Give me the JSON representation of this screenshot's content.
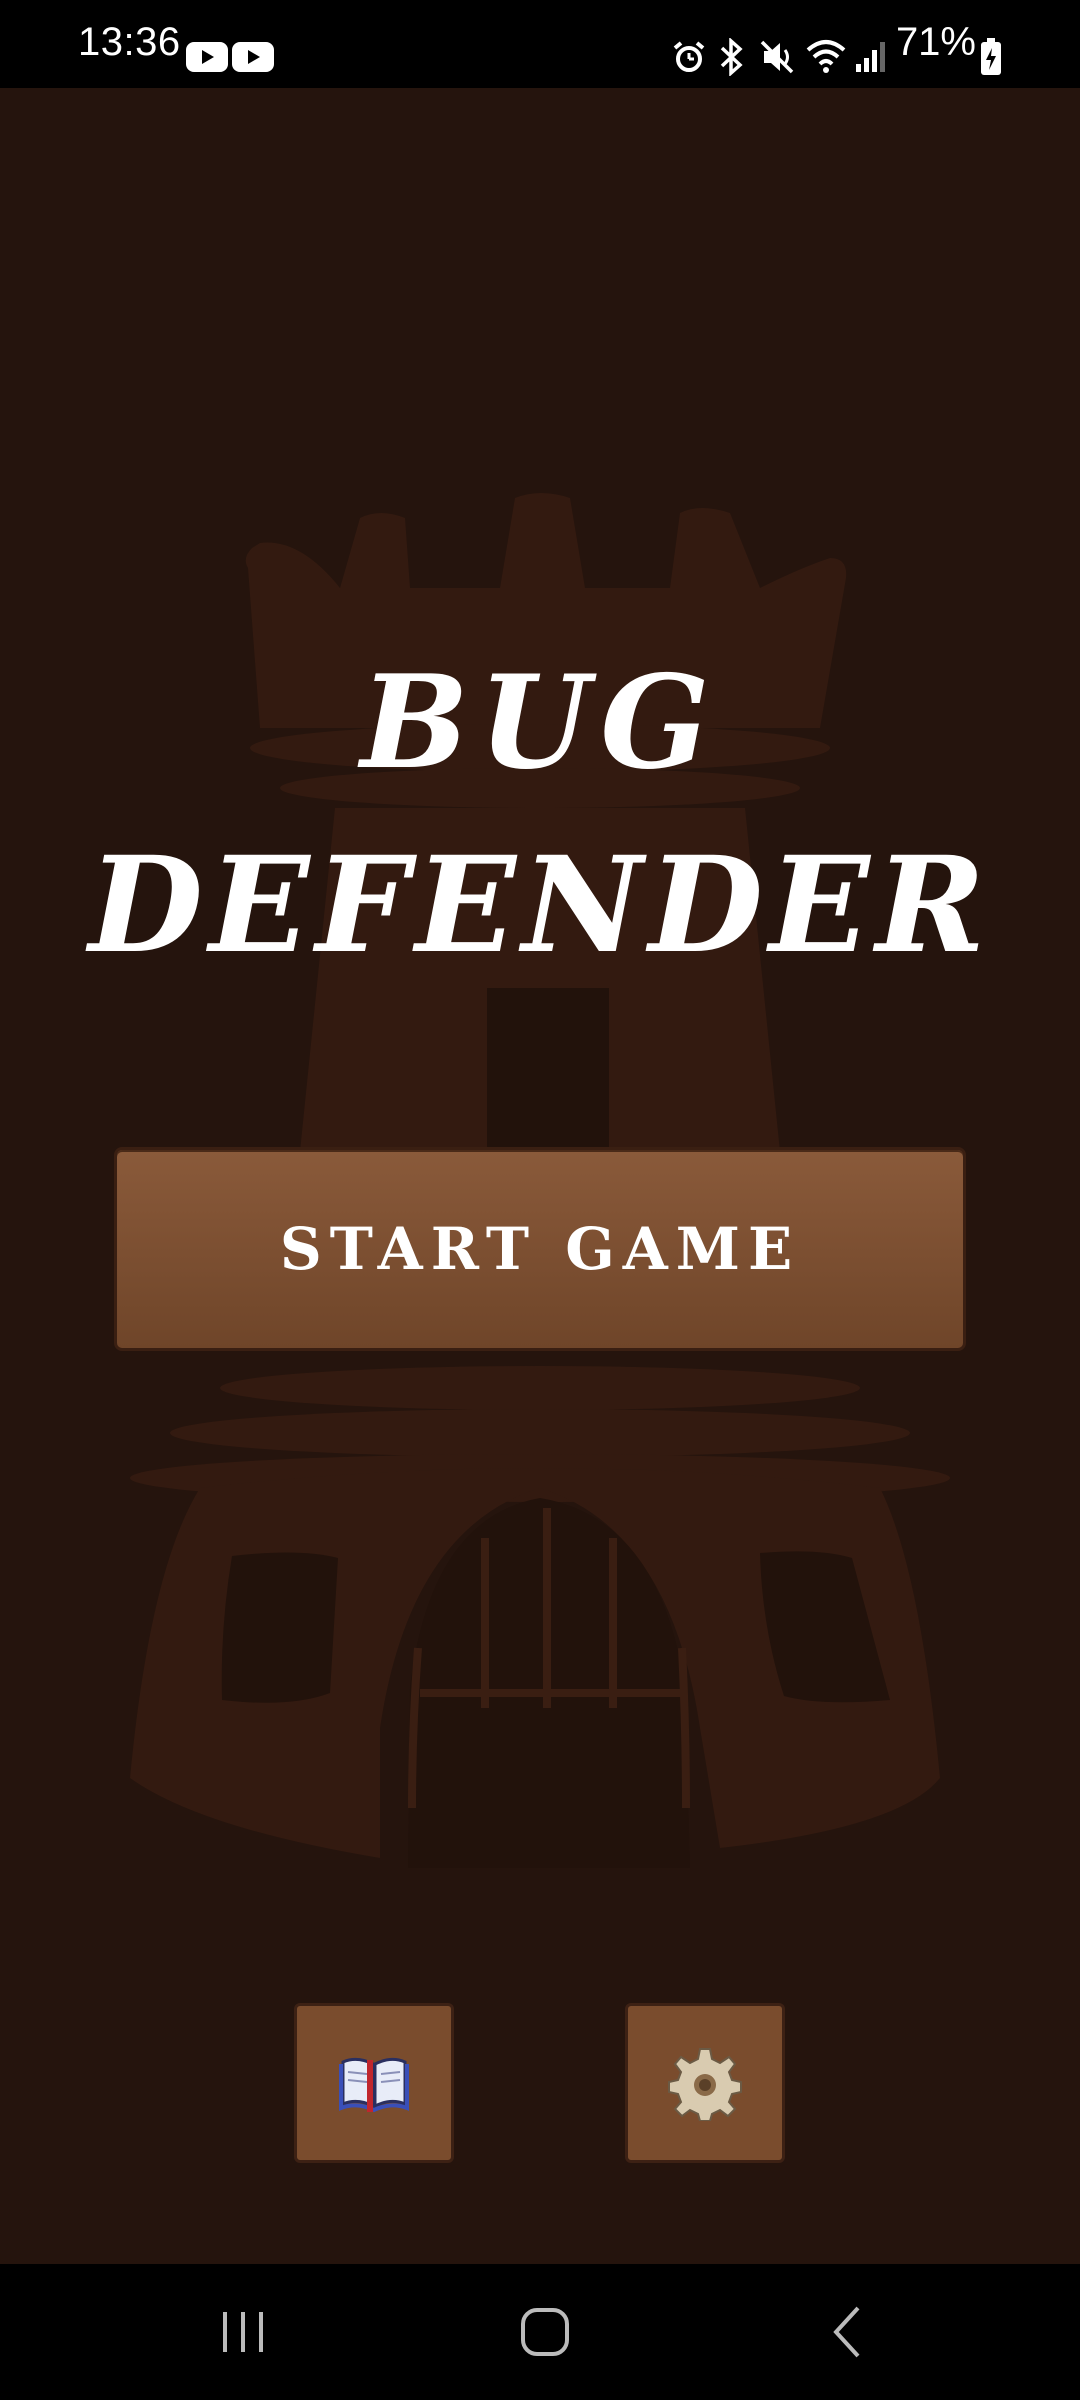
{
  "status_bar": {
    "time": "13:36",
    "battery": "71%",
    "icons": [
      "youtube-icon",
      "youtube-icon",
      "alarm-icon",
      "bluetooth-icon",
      "mute-icon",
      "wifi-icon",
      "signal-icon",
      "battery-icon"
    ]
  },
  "game": {
    "title_line1": "BUG",
    "title_line2": "DEFENDER",
    "start_button": "START GAME",
    "buttons": [
      "book-icon",
      "gear-icon"
    ]
  },
  "colors": {
    "background": "#25140d",
    "tower": "#331a10",
    "button": "#7a4c2d",
    "text": "#ffffff"
  },
  "nav_bar": {
    "buttons": [
      "recents-icon",
      "home-icon",
      "back-icon"
    ]
  }
}
